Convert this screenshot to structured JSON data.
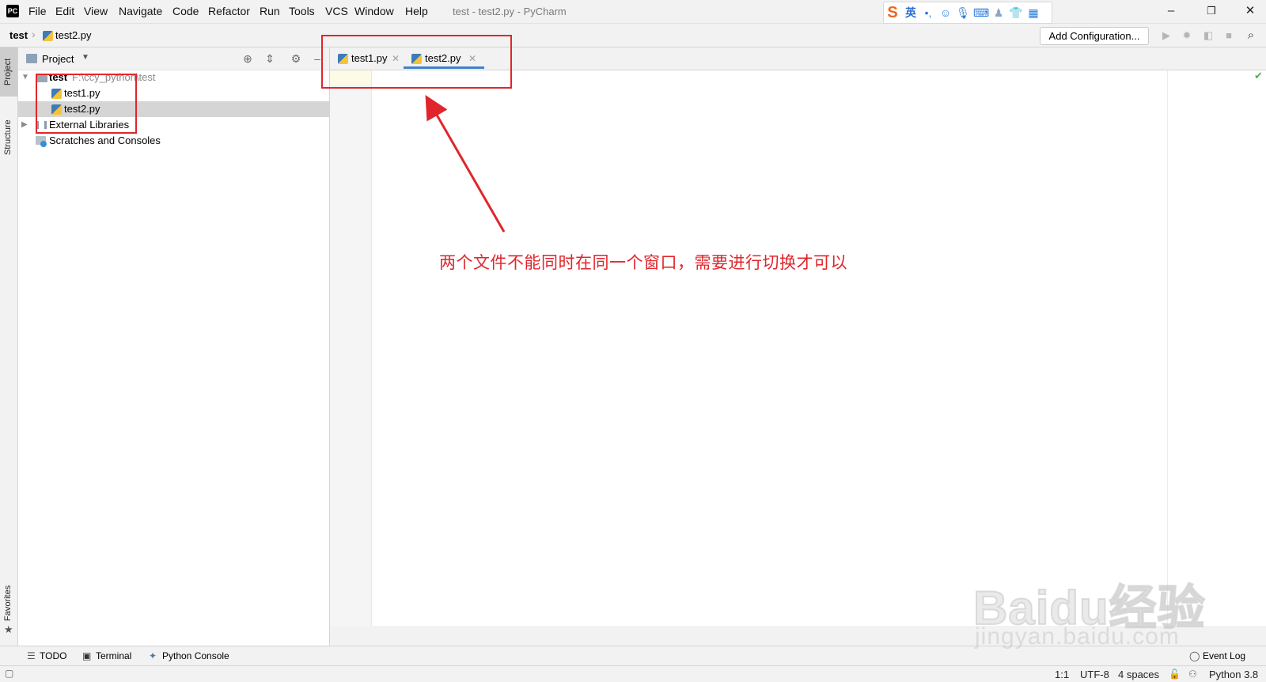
{
  "menu": {
    "items": [
      "File",
      "Edit",
      "View",
      "Navigate",
      "Code",
      "Refactor",
      "Run",
      "Tools",
      "VCS",
      "Window",
      "Help"
    ],
    "window_title": "test - test2.py - PyCharm",
    "ime_label": "英"
  },
  "breadcrumb": {
    "root": "test",
    "file": "test2.py"
  },
  "toolbar": {
    "add_config_label": "Add Configuration..."
  },
  "left_strip": {
    "project_tab": "Project",
    "structure_tab": "Structure",
    "favorites_tab": "Favorites"
  },
  "project_panel": {
    "title": "Project",
    "tree": {
      "root_name": "test",
      "root_path": "F:\\ccy_python\\test",
      "files": [
        "test1.py",
        "test2.py"
      ],
      "external_libraries": "External Libraries",
      "scratches": "Scratches and Consoles"
    }
  },
  "editor": {
    "tabs": [
      {
        "label": "test1.py",
        "active": false
      },
      {
        "label": "test2.py",
        "active": true
      }
    ]
  },
  "annotation": {
    "text": "两个文件不能同时在同一个窗口，需要进行切换才可以"
  },
  "bottom_tools": {
    "todo": "TODO",
    "terminal": "Terminal",
    "python_console": "Python Console",
    "event_log": "Event Log"
  },
  "status_bar": {
    "position": "1:1",
    "encoding": "UTF-8",
    "indent": "4 spaces",
    "interpreter": "Python 3.8"
  },
  "watermark": {
    "main": "Baidu经验",
    "sub": "jingyan.baidu.com"
  },
  "colors": {
    "annotation_red": "#e0262c",
    "active_tab_underline": "#4083c9",
    "selection": "#d5d5d5"
  }
}
